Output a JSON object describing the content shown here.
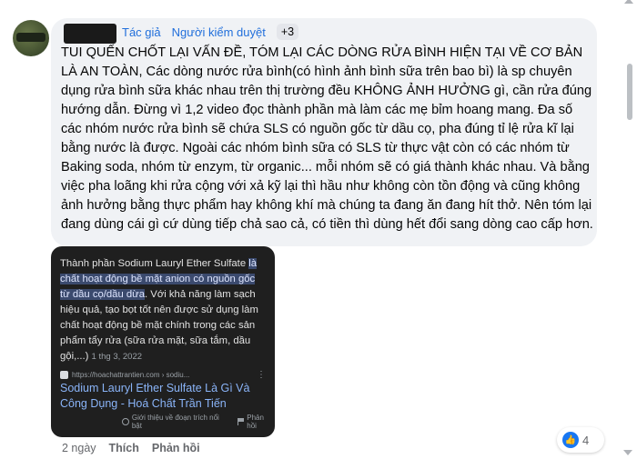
{
  "comment": {
    "badges": [
      "Tác giả",
      "Người kiểm duyệt"
    ],
    "badge_more": "+3",
    "text": "TUI QUẾN CHỐT LẠI VẤN ĐỀ, TÓM LẠI CÁC DÒNG RỬA BÌNH HIỆN TẠI VỀ CƠ BẢN LÀ AN TOÀN, Các dòng nước rửa bình(có hình ảnh bình sữa trên bao bì) là sp chuyên dụng rửa bình sữa khác nhau trên thị trường đều KHÔNG ẢNH HƯỞNG gì, cần rửa đúng hướng dẫn. Đừng vì 1,2 video đọc thành phần mà làm các mẹ bỉm hoang mang. Đa số các nhóm nước rửa bình sẽ chứa SLS có nguồn gốc từ dầu cọ, pha đúng tỉ lệ rửa kĩ lại bằng nước là được. Ngoài các nhóm bình sữa có SLS từ thực vật còn có các nhóm từ Baking soda, nhóm từ enzym, từ organic... mỗi nhóm sẽ có giá thành khác nhau. Và bằng việc pha loãng khi rửa cộng với xả kỹ lại thì hầu như không còn tồn động và cũng không ảnh hưởng bằng thực phẩm hay không khí mà chúng ta đang ăn đang hít thở. Nên tóm lại đang dùng cái gì cứ dùng tiếp chả sao cả, có tiền thì dùng hết đổi sang dòng cao cấp hơn."
  },
  "image_card": {
    "snippet_prefix": "Thành phần Sodium Lauryl Ether Sulfate ",
    "snippet_highlight": "là chất hoạt động bề mặt anion có nguồn gốc từ dầu cọ/dầu dừa",
    "snippet_suffix": ". Với khả năng làm sạch hiệu quả, tạo bọt tốt nên được sử dụng làm chất hoạt động bề mặt chính trong các sản phẩm tẩy rửa (sữa rửa mặt, sữa tắm, dầu gội,...)",
    "snippet_date": "1 thg 3, 2022",
    "source_url": "https://hoachattrantien.com › sodiu...",
    "result_title": "Sodium Lauryl Ether Sulfate Là Gì Và Công Dụng - Hoá Chất Trần Tiến",
    "foot_about": "Giới thiệu về đoạn trích nổi bật",
    "foot_feedback": "Phản hồi"
  },
  "actions": {
    "time": "2 ngày",
    "like": "Thích",
    "reply": "Phản hồi"
  },
  "reactions": {
    "count": "4",
    "icon": "thumbs-up-icon",
    "color": "#1877f2"
  }
}
